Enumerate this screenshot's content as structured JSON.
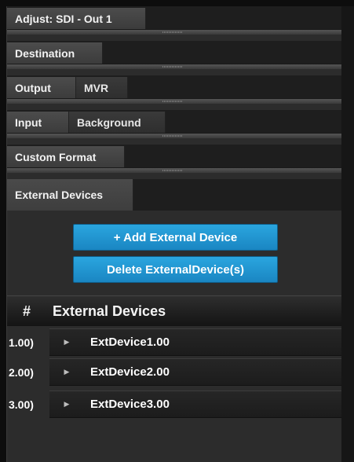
{
  "tabs": {
    "row1": [
      "Adjust: SDI - Out 1"
    ],
    "row2": [
      "Destination"
    ],
    "row3": [
      "Output",
      "MVR"
    ],
    "row4": [
      "Input",
      "Background"
    ],
    "row5": [
      "Custom Format"
    ],
    "row6": [
      "External Devices"
    ]
  },
  "buttons": {
    "add": "+ Add External Device",
    "delete": "Delete ExternalDevice(s)"
  },
  "list": {
    "hash": "#",
    "title": "External Devices",
    "rows": [
      {
        "num": "1.00)",
        "name": "ExtDevice1.00"
      },
      {
        "num": "2.00)",
        "name": "ExtDevice2.00"
      },
      {
        "num": "3.00)",
        "name": "ExtDevice3.00"
      }
    ]
  },
  "colors": {
    "accent": "#1e96d2",
    "panel": "#2c2c2c",
    "background": "#0d0d0d"
  }
}
